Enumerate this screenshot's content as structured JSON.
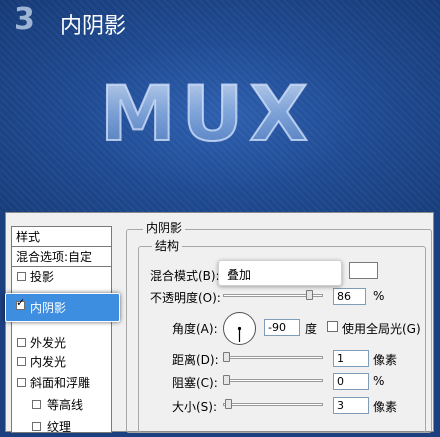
{
  "banner": {
    "step_number": "3",
    "title": "内阴影",
    "logo_text": "MUX"
  },
  "colors": {
    "banner_bg": "#1c3f7f",
    "selection": "#3d8ee0",
    "dialog_bg": "#f0f0f0"
  },
  "styles_panel": {
    "header": "样式",
    "blend_options": "混合选项:自定",
    "items": [
      {
        "label": "投影",
        "checked": false
      },
      {
        "label": "内阴影",
        "checked": true,
        "selected": true
      },
      {
        "label": "外发光",
        "checked": false
      },
      {
        "label": "内发光",
        "checked": false
      },
      {
        "label": "斜面和浮雕",
        "checked": false
      },
      {
        "label": "等高线",
        "checked": false
      },
      {
        "label": "纹理",
        "checked": false
      }
    ]
  },
  "inner_shadow": {
    "section_title": "内阴影",
    "group_title": "结构",
    "blend_mode_label": "混合模式(B):",
    "blend_mode_value": "叠加",
    "opacity_label": "不透明度(O):",
    "opacity_value": "86",
    "opacity_unit": "%",
    "angle_label": "角度(A):",
    "angle_value": "-90",
    "angle_unit": "度",
    "global_light_label": "使用全局光(G)",
    "distance_label": "距离(D):",
    "distance_value": "1",
    "distance_unit": "像素",
    "choke_label": "阻塞(C):",
    "choke_value": "0",
    "choke_unit": "%",
    "size_label": "大小(S):",
    "size_value": "3",
    "size_unit": "像素"
  }
}
